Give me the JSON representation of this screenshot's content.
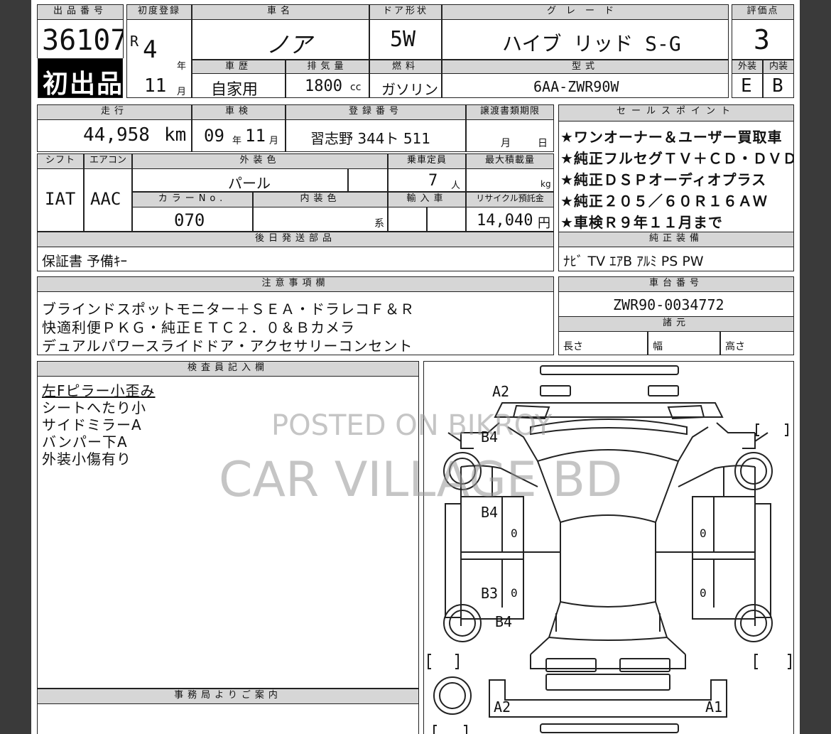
{
  "header": {
    "lot_no_label": "出品番号",
    "lot_no": "36107",
    "first_listing": "初出品",
    "first_reg_label": "初度登録",
    "first_reg_era": "R",
    "first_reg_year": "4",
    "year_unit": "年",
    "first_reg_month": "11",
    "month_unit": "月",
    "car_name_label": "車名",
    "car_name": "ノア",
    "door_label": "ドア形状",
    "door": "5W",
    "grade_label": "グレード",
    "grade": "ハイブ リッド S-G",
    "score_label": "評価点",
    "score": "3",
    "usage_label": "車歴",
    "usage": "自家用",
    "displacement_label": "排気量",
    "displacement": "1800",
    "displacement_unit": "cc",
    "fuel_label": "燃料",
    "fuel": "ガソリン",
    "model_label": "型式",
    "model": "6AA-ZWR90W",
    "exterior_grade_label": "外装",
    "exterior_grade": "E",
    "interior_grade_label": "内装",
    "interior_grade": "B"
  },
  "specs": {
    "mileage_label": "走行",
    "mileage": "44,958",
    "mileage_unit": "km",
    "inspection_label": "車検",
    "inspection_year": "09",
    "inspection_month": "11",
    "plate_label": "登録番号",
    "plate": "習志野 344ト 511",
    "tax_label": "譲渡書類期限",
    "tax_month": "月",
    "tax_day": "日",
    "shift_label": "シフト",
    "shift": "IAT",
    "ac_label": "エアコン",
    "ac": "AAC",
    "exterior_color_label": "外装色",
    "exterior_color": "パール",
    "capacity_label": "乗車定員",
    "capacity": "7",
    "capacity_unit": "人",
    "max_load_label": "最大積載量",
    "max_load_unit": "kg",
    "color_no_label": "カラーNo.",
    "color_no": "070",
    "interior_color_label": "内装色",
    "interior_color_unit": "系",
    "import_label": "輸入車",
    "recycle_label": "リサイクル預託金",
    "recycle": "14,040",
    "recycle_unit": "円"
  },
  "sales_points": {
    "label": "セールスポイント",
    "items": [
      "★ワンオーナー＆ユーザー買取車",
      "★純正フルセグＴＶ＋ＣＤ・ＤＶＤ",
      "★純正ＤＳＰオーディオプラス",
      "★純正２０５／６０Ｒ１６ＡＷ",
      "★車検Ｒ９年１１月まで"
    ]
  },
  "later_parts": {
    "label": "後日発送部品",
    "value": "保証書 予備ｷｰ"
  },
  "equipment": {
    "label": "純正装備",
    "value": "ﾅﾋﾞ TV ｴｱB ｱﾙﾐ PS PW"
  },
  "notes": {
    "label": "注意事項欄",
    "lines": [
      "ブラインドスポットモニター＋ＳＥＡ・ドラレコＦ＆Ｒ",
      "快適利便ＰＫＧ・純正ＥＴＣ２．０＆Ｂカメラ",
      "デュアルパワースライドドア・アクセサリーコンセント"
    ]
  },
  "chassis": {
    "label": "車台番号",
    "value": "ZWR90-0034772",
    "dims_label": "諸元",
    "length_label": "長さ",
    "width_label": "幅",
    "height_label": "高さ"
  },
  "inspector": {
    "label": "検査員記入欄",
    "lines": [
      "左Fピラー小歪み",
      "シートへたり小",
      "サイドミラーA",
      "バンパー下A",
      "外装小傷有り"
    ]
  },
  "office": {
    "label": "事務局よりご案内"
  },
  "diagram": {
    "marks": {
      "front_a2": "A2",
      "hood_b4": "B4",
      "left_front_b4": "B4",
      "left_rear_b3": "B3",
      "left_rear_b4": "B4",
      "rear_a2": "A2",
      "rear_a1": "A1",
      "zero_1": "0",
      "zero_2": "0",
      "zero_3": "0",
      "zero_4": "0"
    }
  },
  "watermark": {
    "line1": "POSTED ON BIKROY",
    "line2": "CAR VILLAGE BD"
  }
}
